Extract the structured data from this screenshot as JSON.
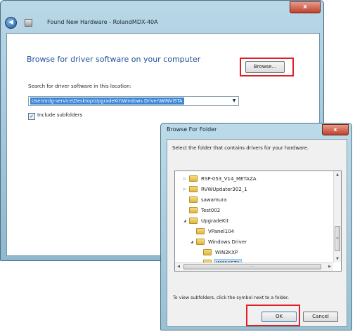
{
  "wizard": {
    "title": "Found New Hardware - RolandMDX-40A",
    "close_glyph": "x",
    "back_glyph": "◀",
    "heading": "Browse for driver software on your computer",
    "search_label": "Search for driver software in this location:",
    "path_value": "Users\\rdg-service\\Desktop\\UpgradeKit\\Windows Driver\\WINVISTA",
    "combo_arrow": "▼",
    "browse_label": "Browse...",
    "include_subfolders_label": "Include subfolders",
    "include_subfolders_checked": true,
    "check_glyph": "✓"
  },
  "dialog": {
    "title": "Browse For Folder",
    "close_glyph": "x",
    "instruction": "Select the folder that contains drivers for your hardware.",
    "tree": [
      {
        "label": "RSP-053_V14_METAZA",
        "expander": "▷",
        "depth": 1
      },
      {
        "label": "RVWUpdater302_1",
        "expander": "▷",
        "depth": 1
      },
      {
        "label": "sawamura",
        "expander": "",
        "depth": 1
      },
      {
        "label": "Test002",
        "expander": "",
        "depth": 1
      },
      {
        "label": "UpgradeKit",
        "expander": "◢",
        "depth": 1
      },
      {
        "label": "VPanel104",
        "expander": "",
        "depth": 2
      },
      {
        "label": "Windows Driver",
        "expander": "◢",
        "depth": 2
      },
      {
        "label": "WIN2KXP",
        "expander": "",
        "depth": 3
      },
      {
        "label": "WINVISTA",
        "expander": "",
        "depth": 3,
        "selected": true
      }
    ],
    "scroll_up": "▲",
    "scroll_down": "▼",
    "scroll_left": "◀",
    "scroll_right": "▶",
    "scroll_grip_v": "≡",
    "scroll_grip_h": "⋯",
    "hint": "To view subfolders, click the symbol next to a folder.",
    "ok_label": "OK",
    "cancel_label": "Cancel"
  },
  "colors": {
    "highlight_box": "#e01e26",
    "heading_blue": "#1f4e9a",
    "selection_blue": "#3b86d4"
  }
}
